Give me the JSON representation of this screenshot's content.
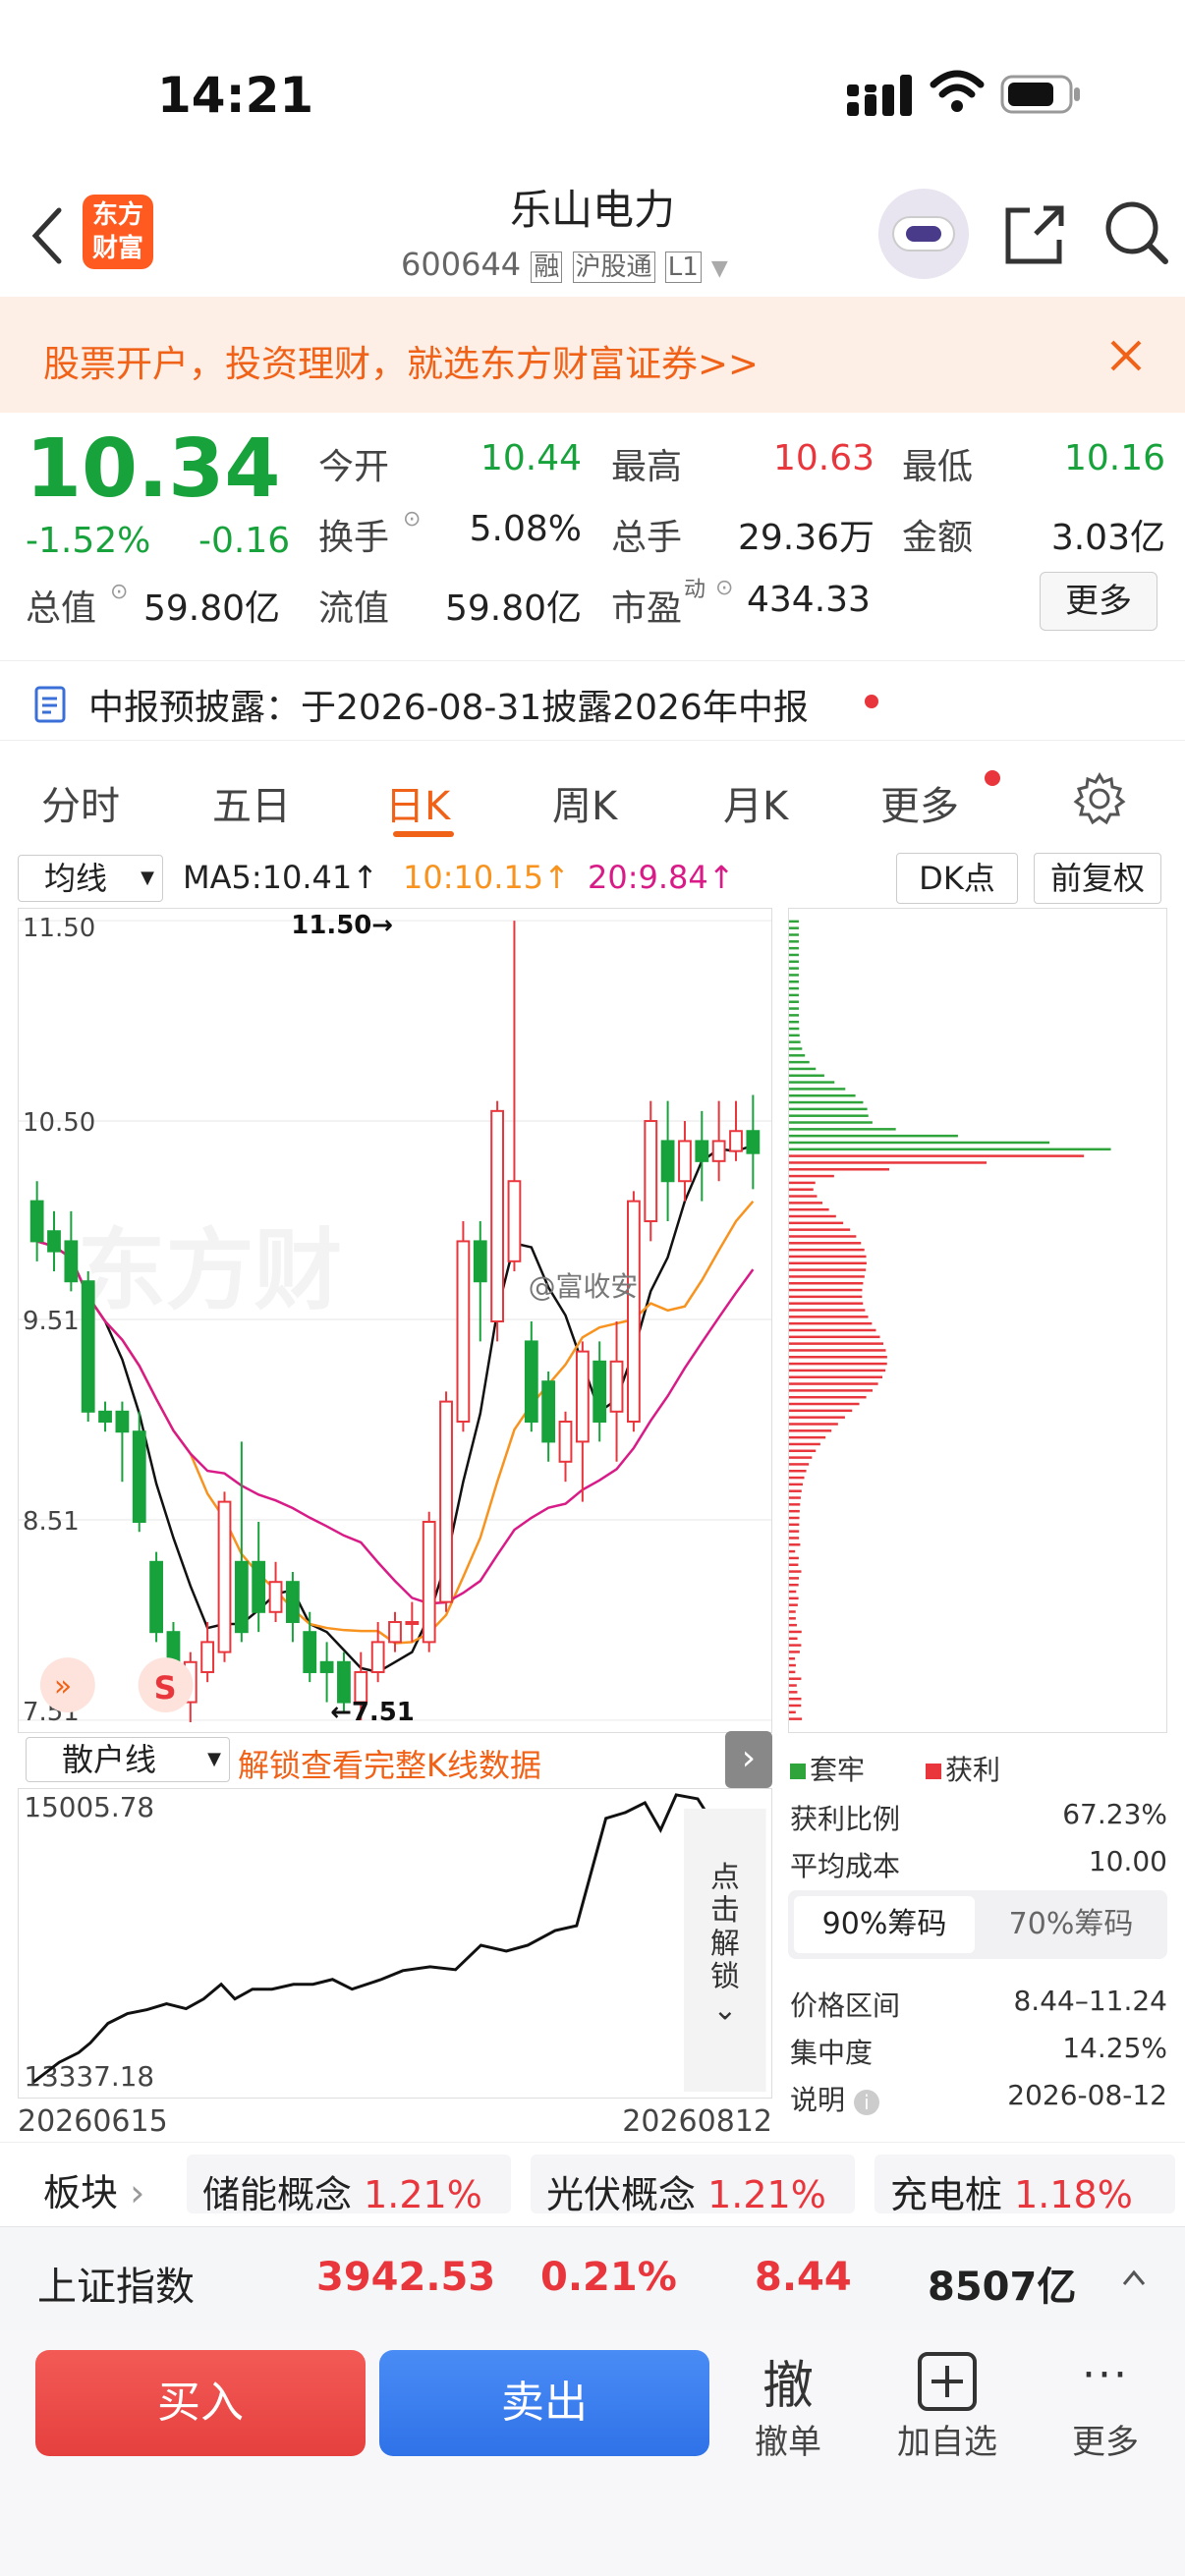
{
  "status": {
    "time": "14:21"
  },
  "header": {
    "title": "乐山电力",
    "code": "600644",
    "badges": [
      "融",
      "沪股通",
      "L1"
    ],
    "logo_text": "东方\n财富"
  },
  "banner": {
    "text": "股票开户，投资理财，就选东方财富证券>>"
  },
  "quote": {
    "price": "10.34",
    "change_pct": "-1.52%",
    "change": "-0.16",
    "fields": [
      {
        "label": "今开",
        "value": "10.44",
        "color": "green"
      },
      {
        "label": "最高",
        "value": "10.63",
        "color": "red"
      },
      {
        "label": "最低",
        "value": "10.16",
        "color": "green"
      },
      {
        "label": "换手",
        "value": "5.08%",
        "color": "dark"
      },
      {
        "label": "总手",
        "value": "29.36万",
        "color": "dark"
      },
      {
        "label": "金额",
        "value": "3.03亿",
        "color": "dark"
      },
      {
        "label": "流值",
        "value": "59.80亿",
        "color": "dark"
      },
      {
        "label": "市盈",
        "value": "434.33",
        "color": "dark"
      }
    ],
    "total_label": "总值",
    "total_value": "59.80亿",
    "pe_sup": "动",
    "more": "更多"
  },
  "notice": {
    "text": "中报预披露：于2026-08-31披露2026年中报"
  },
  "tabs": [
    "分时",
    "五日",
    "日K",
    "周K",
    "月K",
    "更多"
  ],
  "active_tab": "日K",
  "ma": {
    "select": "均线",
    "ma5": "MA5:10.41↑",
    "ma10": "10:10.15↑",
    "ma20": "20:9.84↑",
    "dk": "DK点",
    "fq": "前复权"
  },
  "chart_data": {
    "type": "candlestick",
    "y_ticks": [
      "11.50",
      "10.50",
      "9.51",
      "8.51",
      "7.51"
    ],
    "ylim": [
      7.51,
      11.5
    ],
    "high_label": "11.50→",
    "low_label": "←7.51",
    "watermark": "东方财",
    "overlay": "@富收安",
    "candles": [
      [
        10.1,
        9.9,
        10.2,
        9.8
      ],
      [
        9.95,
        9.85,
        10.05,
        9.75
      ],
      [
        9.9,
        9.7,
        10.05,
        9.65
      ],
      [
        9.7,
        9.05,
        9.75,
        9.0
      ],
      [
        9.05,
        9.0,
        9.1,
        8.95
      ],
      [
        9.05,
        8.95,
        9.1,
        8.7
      ],
      [
        8.95,
        8.5,
        9.05,
        8.45
      ],
      [
        8.3,
        7.95,
        8.35,
        7.9
      ],
      [
        7.95,
        7.7,
        8.0,
        7.65
      ],
      [
        7.6,
        7.8,
        7.85,
        7.5
      ],
      [
        7.75,
        7.9,
        8.0,
        7.7
      ],
      [
        7.85,
        8.6,
        8.65,
        7.8
      ],
      [
        8.3,
        7.95,
        8.9,
        7.9
      ],
      [
        8.3,
        8.05,
        8.5,
        7.95
      ],
      [
        8.05,
        8.2,
        8.3,
        8.0
      ],
      [
        8.2,
        8.0,
        8.25,
        7.9
      ],
      [
        7.95,
        7.75,
        8.05,
        7.7
      ],
      [
        7.8,
        7.75,
        7.9,
        7.6
      ],
      [
        7.8,
        7.6,
        7.85,
        7.55
      ],
      [
        7.6,
        7.75,
        7.85,
        7.51
      ],
      [
        7.75,
        7.9,
        8.0,
        7.7
      ],
      [
        7.9,
        8.0,
        8.05,
        7.85
      ],
      [
        8.0,
        8.0,
        8.1,
        7.9
      ],
      [
        7.9,
        8.5,
        8.55,
        7.85
      ],
      [
        8.1,
        9.1,
        9.15,
        8.05
      ],
      [
        9.0,
        9.9,
        10.0,
        8.95
      ],
      [
        9.9,
        9.7,
        10.0,
        9.4
      ],
      [
        9.5,
        10.55,
        10.6,
        9.4
      ],
      [
        9.8,
        10.2,
        11.5,
        9.75
      ],
      [
        9.4,
        9.0,
        9.5,
        8.95
      ],
      [
        9.2,
        8.9,
        9.25,
        8.8
      ],
      [
        8.8,
        9.0,
        9.05,
        8.7
      ],
      [
        8.9,
        9.35,
        9.4,
        8.6
      ],
      [
        9.3,
        9.0,
        9.4,
        8.9
      ],
      [
        9.05,
        9.3,
        9.5,
        8.8
      ],
      [
        9.0,
        10.1,
        10.15,
        8.95
      ],
      [
        10.0,
        10.5,
        10.6,
        9.9
      ],
      [
        10.4,
        10.2,
        10.6,
        10.0
      ],
      [
        10.2,
        10.4,
        10.5,
        10.1
      ],
      [
        10.4,
        10.3,
        10.55,
        10.1
      ],
      [
        10.3,
        10.4,
        10.6,
        10.2
      ],
      [
        10.35,
        10.45,
        10.6,
        10.3
      ],
      [
        10.45,
        10.34,
        10.63,
        10.16
      ]
    ]
  },
  "subchart": {
    "select": "散户线",
    "unlock": "解锁查看完整K线数据",
    "max": "15005.78",
    "min": "13337.18",
    "date_start": "20260615",
    "date_end": "20260812",
    "cta": "点击解锁"
  },
  "chip": {
    "legend_trap": "套牢",
    "legend_profit": "获利",
    "rows": [
      {
        "label": "获利比例",
        "value": "67.23%"
      },
      {
        "label": "平均成本",
        "value": "10.00"
      }
    ],
    "tab1": "90%筹码",
    "tab2": "70%筹码",
    "rows2": [
      {
        "label": "价格区间",
        "value": "8.44–11.24"
      },
      {
        "label": "集中度",
        "value": "14.25%"
      },
      {
        "label": "说明",
        "value": "2026-08-12"
      }
    ]
  },
  "sectors": {
    "label": "板块",
    "items": [
      {
        "name": "储能概念",
        "pct": "1.21%"
      },
      {
        "name": "光伏概念",
        "pct": "1.21%"
      },
      {
        "name": "充电桩",
        "pct": "1.18%"
      }
    ]
  },
  "index": {
    "name": "上证指数",
    "value": "3942.53",
    "pct": "0.21%",
    "change": "8.44",
    "volume": "8507亿"
  },
  "bottom": {
    "buy": "买入",
    "sell": "卖出",
    "cancel_icon": "撤",
    "cancel": "撤单",
    "add": "加自选",
    "more": "更多"
  }
}
